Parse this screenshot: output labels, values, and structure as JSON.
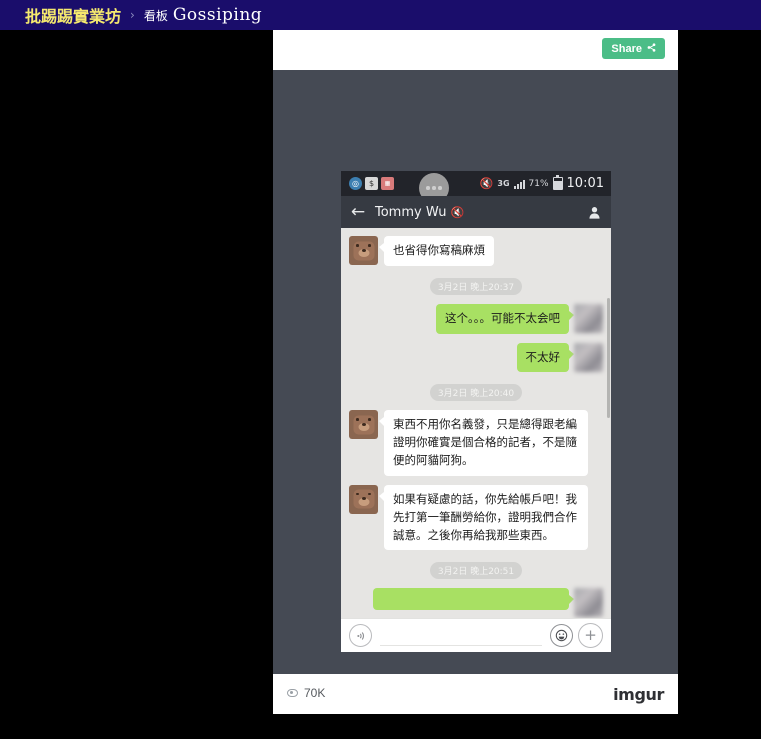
{
  "ptt_nav": {
    "brand": "批踢踢實業坊",
    "separator": "›",
    "board_label": "看板",
    "board_name": "Gossiping"
  },
  "imgur": {
    "share_label": "Share",
    "share_icon": "share-icon",
    "views_count": "70K",
    "views_icon": "eye-icon",
    "logo": "imgur"
  },
  "phone": {
    "status_bar": {
      "left_icons": [
        "compass-icon",
        "dollar-icon",
        "calendar-icon"
      ],
      "notification_dots": "more-dots-icon",
      "mute_icon": "mute-speaker-icon",
      "network": "3G",
      "signal_icon": "signal-bars-icon",
      "battery_percent": "71%",
      "battery_icon": "battery-icon",
      "clock": "10:01"
    },
    "titlebar": {
      "back_icon": "back-arrow-icon",
      "contact_name": "Tommy Wu",
      "mute_mark": "mute-notification-icon",
      "profile_icon": "profile-person-icon"
    },
    "messages": [
      {
        "type": "message",
        "side": "left",
        "avatar": "bear-avatar",
        "text": "也省得你寫稿麻煩"
      },
      {
        "type": "daystamp",
        "text": "3月2日 晚上20:37"
      },
      {
        "type": "message",
        "side": "right",
        "avatar": "censored-avatar",
        "text": "这个。。。可能不太会吧"
      },
      {
        "type": "message",
        "side": "right",
        "avatar": "censored-avatar",
        "text": "不太好"
      },
      {
        "type": "daystamp",
        "text": "3月2日 晚上20:40"
      },
      {
        "type": "message",
        "side": "left",
        "avatar": "bear-avatar",
        "text": "東西不用你名義發，只是總得跟老編證明你確實是個合格的記者，不是隨便的阿貓阿狗。"
      },
      {
        "type": "message",
        "side": "left",
        "avatar": "bear-avatar",
        "text": "如果有疑慮的話，你先給帳戶吧！我先打第一筆酬勞給你，證明我們合作誠意。之後你再給我那些東西。"
      },
      {
        "type": "daystamp",
        "text": "3月2日 晚上20:51"
      },
      {
        "type": "message",
        "side": "right",
        "avatar": "censored-avatar",
        "text": ""
      }
    ],
    "inputbar": {
      "voice_icon": "voice-wave-icon",
      "input_value": "",
      "input_placeholder": "",
      "emoji_icon": "emoji-smiley-icon",
      "plus_icon": "plus-icon"
    }
  },
  "colors": {
    "nav_background": "#1a0d6b",
    "brand_yellow": "#f5e96e",
    "share_green": "#4bbd87",
    "bubble_green": "#a8e063",
    "stage_dark": "#454a54",
    "chat_background": "#e6e5e3"
  }
}
